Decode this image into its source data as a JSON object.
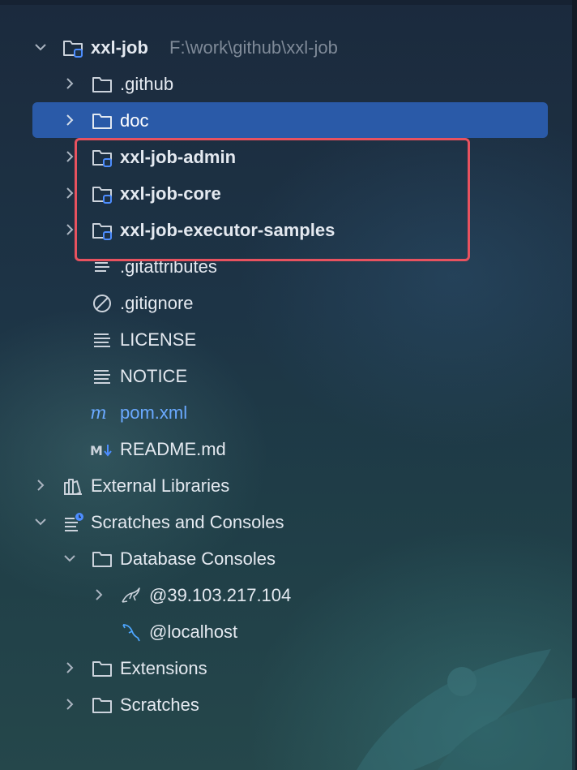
{
  "project": {
    "name": "xxl-job",
    "path": "F:\\work\\github\\xxl-job"
  },
  "items": [
    {
      "label": ".github"
    },
    {
      "label": "doc"
    },
    {
      "label": "xxl-job-admin"
    },
    {
      "label": "xxl-job-core"
    },
    {
      "label": "xxl-job-executor-samples"
    },
    {
      "label": ".gitattributes"
    },
    {
      "label": ".gitignore"
    },
    {
      "label": "LICENSE"
    },
    {
      "label": "NOTICE"
    },
    {
      "label": "pom.xml"
    },
    {
      "label": "README.md"
    }
  ],
  "external_libraries": {
    "label": "External Libraries"
  },
  "scratches": {
    "label": "Scratches and Consoles",
    "database_consoles": {
      "label": "Database Consoles",
      "connections": [
        {
          "label": "@39.103.217.104"
        },
        {
          "label": "@localhost"
        }
      ]
    },
    "extensions": {
      "label": "Extensions"
    },
    "scratches_folder": {
      "label": "Scratches"
    }
  },
  "colors": {
    "selected": "#2a5aa8",
    "highlight_border": "#e8525f",
    "maven_file": "#6aa9ff",
    "module_badge": "#4d8dff"
  },
  "icons": {
    "folder": "folder-icon",
    "module": "module-folder-icon",
    "text": "text-file-icon",
    "ignore": "ignore-file-icon",
    "maven": "maven-icon",
    "markdown": "markdown-icon",
    "libraries": "libraries-icon",
    "scratches": "scratches-icon",
    "mysql": "mysql-icon"
  }
}
